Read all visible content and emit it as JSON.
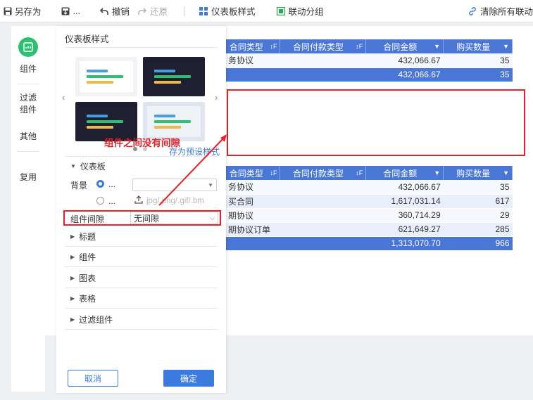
{
  "toolbar": {
    "save_as": "另存为",
    "more": "...",
    "undo": "撤销",
    "redo": "还原",
    "dashboard_style": "仪表板样式",
    "linkage_group": "联动分组",
    "clear_linkage": "清除所有联动"
  },
  "sidebar": {
    "items": [
      "组件",
      "过滤\n组件",
      "其他",
      "复用"
    ],
    "item_component": "组件",
    "item_filter_1": "过滤",
    "item_filter_2": "组件",
    "item_other": "其他",
    "item_reuse": "复用"
  },
  "panel": {
    "title": "仪表板样式",
    "save_preset": "存为预设样式",
    "section_dashboard": "仪表板",
    "background_label": "背景",
    "bg_option1": "...",
    "bg_option2": "...",
    "upload_hint": "jpg/.png/.gif/.bm",
    "gap_label": "组件间隙",
    "gap_value": "无间隙",
    "sections": [
      "标题",
      "组件",
      "图表",
      "表格",
      "过滤组件"
    ],
    "cancel": "取消",
    "confirm": "确定"
  },
  "annotation": {
    "note": "组件之间没有间隙",
    "color": "#e8202a"
  },
  "table_top": {
    "headers": [
      "合同类型",
      "合同付款类型",
      "合同金额",
      "购买数量"
    ],
    "rows": [
      [
        "务协议",
        "",
        "432,066.67",
        "35"
      ]
    ],
    "total": [
      "",
      "",
      "432,066.67",
      "35"
    ]
  },
  "table_bottom": {
    "headers": [
      "合同类型",
      "合同付款类型",
      "合同金额",
      "购买数量"
    ],
    "rows": [
      [
        "务协议",
        "",
        "432,066.67",
        "35"
      ],
      [
        "买合同",
        "",
        "1,617,031.14",
        "617"
      ],
      [
        "期协议",
        "",
        "360,714.29",
        "29"
      ],
      [
        "期协议订单",
        "",
        "621,649.27",
        "285"
      ]
    ],
    "total": [
      "",
      "",
      "1,313,070.70",
      "966"
    ]
  },
  "colors": {
    "accent": "#3b7be0",
    "table_header": "#4a76d6",
    "logo": "#2fbf71",
    "highlight": "#e8202a"
  }
}
